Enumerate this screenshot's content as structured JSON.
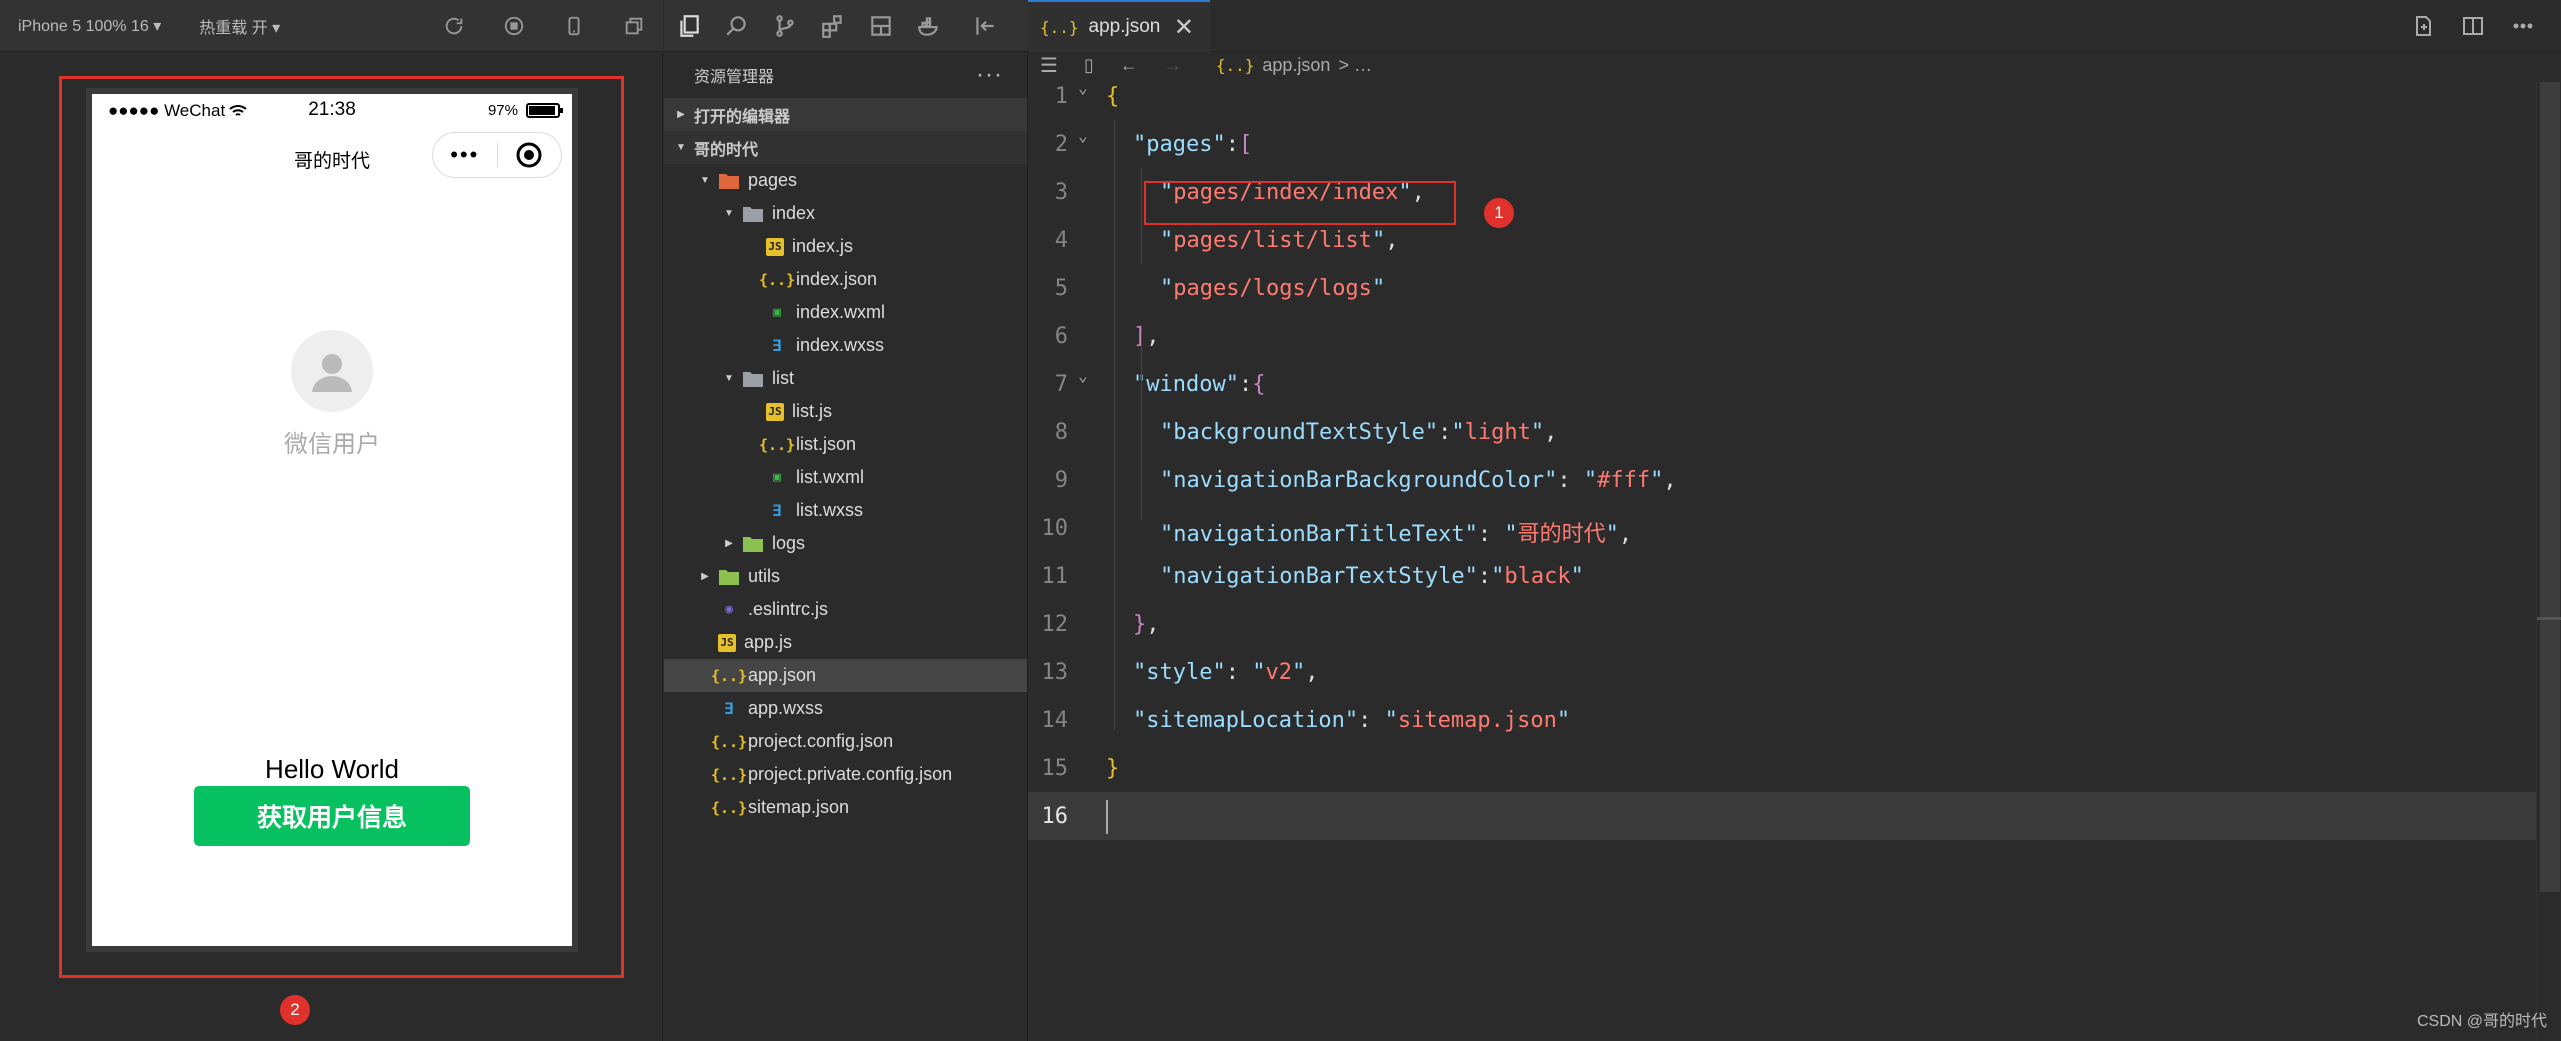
{
  "simulator": {
    "device_label": "iPhone 5 100% 16 ▾",
    "hot_reload_label": "热重载 开 ▾",
    "status": {
      "carrier": "●●●●● WeChat",
      "time": "21:38",
      "battery": "97%"
    },
    "nav_title": "哥的时代",
    "capsule_more": "•••",
    "user_nickname": "微信用户",
    "hello_text": "Hello World",
    "button_label": "获取用户信息"
  },
  "badges": {
    "one": "1",
    "two": "2"
  },
  "explorer": {
    "title": "资源管理器",
    "more": "···",
    "open_editors": "打开的编辑器",
    "project": "哥的时代",
    "tree": [
      {
        "label": "pages",
        "depth": 1,
        "type": "folder-pages",
        "caret": "▼"
      },
      {
        "label": "index",
        "depth": 2,
        "type": "folder",
        "caret": "▼"
      },
      {
        "label": "index.js",
        "depth": 3,
        "type": "js",
        "caret": ""
      },
      {
        "label": "index.json",
        "depth": 3,
        "type": "json",
        "caret": ""
      },
      {
        "label": "index.wxml",
        "depth": 3,
        "type": "wxml",
        "caret": ""
      },
      {
        "label": "index.wxss",
        "depth": 3,
        "type": "wxss",
        "caret": ""
      },
      {
        "label": "list",
        "depth": 2,
        "type": "folder",
        "caret": "▼"
      },
      {
        "label": "list.js",
        "depth": 3,
        "type": "js",
        "caret": ""
      },
      {
        "label": "list.json",
        "depth": 3,
        "type": "json",
        "caret": ""
      },
      {
        "label": "list.wxml",
        "depth": 3,
        "type": "wxml",
        "caret": ""
      },
      {
        "label": "list.wxss",
        "depth": 3,
        "type": "wxss",
        "caret": ""
      },
      {
        "label": "logs",
        "depth": 2,
        "type": "folder-green",
        "caret": "▶"
      },
      {
        "label": "utils",
        "depth": 1,
        "type": "folder-green",
        "caret": "▶"
      },
      {
        "label": ".eslintrc.js",
        "depth": 1,
        "type": "eslint",
        "caret": ""
      },
      {
        "label": "app.js",
        "depth": 1,
        "type": "js",
        "caret": ""
      },
      {
        "label": "app.json",
        "depth": 1,
        "type": "json",
        "caret": "",
        "selected": true
      },
      {
        "label": "app.wxss",
        "depth": 1,
        "type": "wxss",
        "caret": ""
      },
      {
        "label": "project.config.json",
        "depth": 1,
        "type": "json",
        "caret": ""
      },
      {
        "label": "project.private.config.json",
        "depth": 1,
        "type": "json",
        "caret": ""
      },
      {
        "label": "sitemap.json",
        "depth": 1,
        "type": "json",
        "caret": ""
      }
    ]
  },
  "editor": {
    "tab_label": "app.json",
    "tab_close": "✕",
    "breadcrumb_file": "app.json",
    "breadcrumb_rest": "> …",
    "lines": [
      {
        "n": "1",
        "fold": true,
        "indent": 0,
        "tokens": [
          [
            "br",
            "{"
          ]
        ]
      },
      {
        "n": "2",
        "fold": true,
        "indent": 1,
        "tokens": [
          [
            "k",
            "\"pages\""
          ],
          [
            "w",
            ":"
          ],
          [
            "pb",
            "["
          ]
        ]
      },
      {
        "n": "3",
        "fold": false,
        "indent": 2,
        "tokens": [
          [
            "k",
            "\""
          ],
          [
            "s",
            "pages/index/index"
          ],
          [
            "k",
            "\""
          ],
          [
            "w",
            ","
          ]
        ]
      },
      {
        "n": "4",
        "fold": false,
        "indent": 2,
        "tokens": [
          [
            "k",
            "\""
          ],
          [
            "s",
            "pages/list/list"
          ],
          [
            "k",
            "\""
          ],
          [
            "w",
            ","
          ]
        ]
      },
      {
        "n": "5",
        "fold": false,
        "indent": 2,
        "tokens": [
          [
            "k",
            "\""
          ],
          [
            "s",
            "pages/logs/logs"
          ],
          [
            "k",
            "\""
          ]
        ]
      },
      {
        "n": "6",
        "fold": false,
        "indent": 1,
        "tokens": [
          [
            "pb",
            "]"
          ],
          [
            "w",
            ","
          ]
        ]
      },
      {
        "n": "7",
        "fold": true,
        "indent": 1,
        "tokens": [
          [
            "k",
            "\"window\""
          ],
          [
            "w",
            ":"
          ],
          [
            "p",
            "{"
          ]
        ]
      },
      {
        "n": "8",
        "fold": false,
        "indent": 2,
        "tokens": [
          [
            "k",
            "\"backgroundTextStyle\""
          ],
          [
            "w",
            ":"
          ],
          [
            "k",
            "\""
          ],
          [
            "s",
            "light"
          ],
          [
            "k",
            "\""
          ],
          [
            "w",
            ","
          ]
        ]
      },
      {
        "n": "9",
        "fold": false,
        "indent": 2,
        "tokens": [
          [
            "k",
            "\"navigationBarBackgroundColor\""
          ],
          [
            "w",
            ": "
          ],
          [
            "k",
            "\""
          ],
          [
            "s",
            "#fff"
          ],
          [
            "k",
            "\""
          ],
          [
            "w",
            ","
          ]
        ]
      },
      {
        "n": "10",
        "fold": false,
        "indent": 2,
        "tokens": [
          [
            "k",
            "\"navigationBarTitleText\""
          ],
          [
            "w",
            ": "
          ],
          [
            "k",
            "\""
          ],
          [
            "s",
            "哥的时代"
          ],
          [
            "k",
            "\""
          ],
          [
            "w",
            ","
          ]
        ]
      },
      {
        "n": "11",
        "fold": false,
        "indent": 2,
        "tokens": [
          [
            "k",
            "\"navigationBarTextStyle\""
          ],
          [
            "w",
            ":"
          ],
          [
            "k",
            "\""
          ],
          [
            "s",
            "black"
          ],
          [
            "k",
            "\""
          ]
        ]
      },
      {
        "n": "12",
        "fold": false,
        "indent": 1,
        "tokens": [
          [
            "p",
            "}"
          ],
          [
            "w",
            ","
          ]
        ]
      },
      {
        "n": "13",
        "fold": false,
        "indent": 1,
        "tokens": [
          [
            "k",
            "\"style\""
          ],
          [
            "w",
            ": "
          ],
          [
            "k",
            "\""
          ],
          [
            "s",
            "v2"
          ],
          [
            "k",
            "\""
          ],
          [
            "w",
            ","
          ]
        ]
      },
      {
        "n": "14",
        "fold": false,
        "indent": 1,
        "tokens": [
          [
            "k",
            "\"sitemapLocation\""
          ],
          [
            "w",
            ": "
          ],
          [
            "k",
            "\""
          ],
          [
            "s",
            "sitemap.json"
          ],
          [
            "k",
            "\""
          ]
        ]
      },
      {
        "n": "15",
        "fold": false,
        "indent": 0,
        "tokens": [
          [
            "br",
            "}"
          ]
        ]
      },
      {
        "n": "16",
        "fold": false,
        "indent": 0,
        "tokens": [],
        "current": true
      }
    ]
  },
  "watermark": "CSDN @哥的时代",
  "colors": {
    "highlight_red": "#e0312c",
    "wechat_green": "#07c160",
    "accent_blue": "#2f7bd6"
  }
}
